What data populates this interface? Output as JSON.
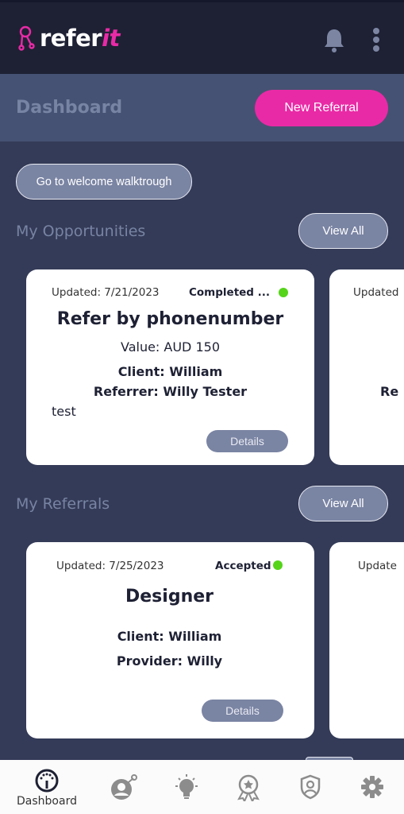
{
  "header": {
    "logo_text": "refer",
    "logo_accent": "it",
    "brand_color": "#e92aa6"
  },
  "subheader": {
    "title": "Dashboard",
    "new_referral": "New Referral"
  },
  "walkthrough": "Go to welcome walktrough",
  "opportunities": {
    "title": "My Opportunities",
    "view_all": "View All",
    "cards": [
      {
        "updated": "Updated: 7/21/2023",
        "status": "Completed ...",
        "title": "Refer by phonenumber",
        "value": "Value: AUD 150",
        "client": "Client: William",
        "referrer": "Referrer: Willy Tester",
        "note": "test",
        "details": "Details"
      },
      {
        "updated": "Updated",
        "referrer": "Re"
      }
    ]
  },
  "referrals": {
    "title": "My Referrals",
    "view_all": "View All",
    "cards": [
      {
        "updated": "Updated: 7/25/2023",
        "status": "Accepted",
        "title": "Designer",
        "client": "Client: William",
        "provider": "Provider: Willy",
        "details": "Details"
      },
      {
        "updated": "Update"
      }
    ]
  },
  "nav": {
    "items": [
      {
        "label": "Dashboard",
        "icon": "gauge-icon",
        "active": true
      },
      {
        "icon": "user-referral-icon"
      },
      {
        "icon": "lightbulb-icon"
      },
      {
        "icon": "award-icon"
      },
      {
        "icon": "shield-user-icon"
      },
      {
        "icon": "gear-icon"
      }
    ]
  }
}
